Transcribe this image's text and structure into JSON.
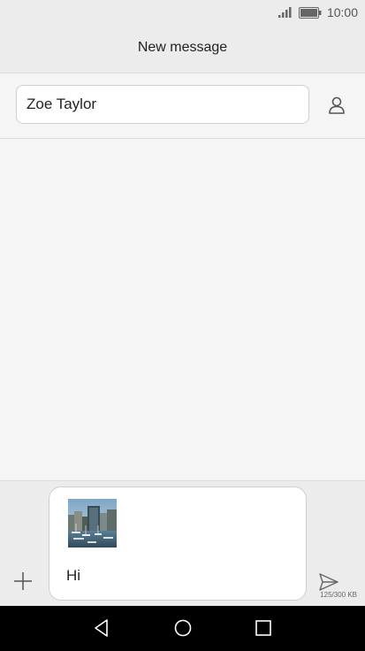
{
  "status_bar": {
    "time": "10:00",
    "icons": [
      "signal-icon",
      "battery-icon"
    ]
  },
  "header": {
    "title": "New message"
  },
  "recipient": {
    "value": "Zoe Taylor",
    "contact_icon": "person-icon"
  },
  "compose": {
    "attachment": "image-attachment",
    "message_text": "Hi",
    "size_indicator": "125/300 KB",
    "add_icon": "plus-icon",
    "send_icon": "send-icon"
  },
  "nav_bar": {
    "buttons": [
      "back-icon",
      "home-icon",
      "recent-apps-icon"
    ]
  },
  "colors": {
    "background": "#f5f5f5",
    "bar": "#ececec",
    "nav": "#000000",
    "field_border": "#cfcfcf"
  }
}
